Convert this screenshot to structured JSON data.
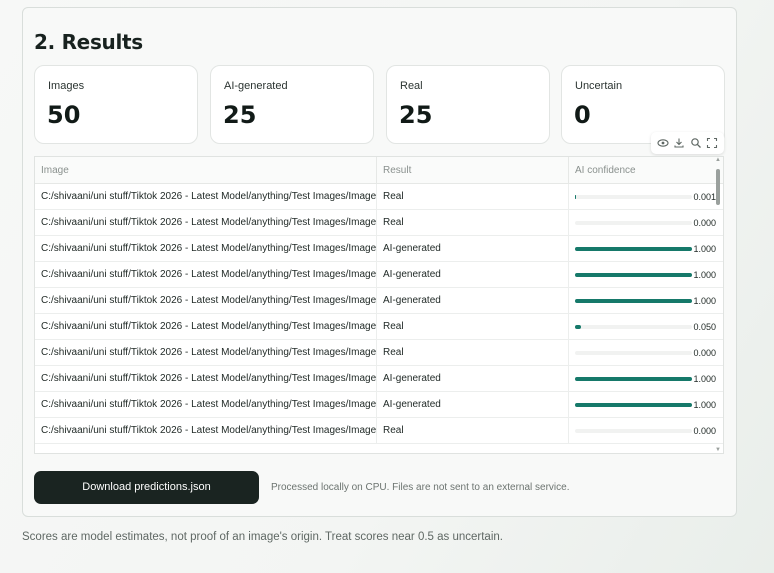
{
  "section": {
    "title": "2. Results"
  },
  "metrics": [
    {
      "label": "Images",
      "value": "50"
    },
    {
      "label": "AI-generated",
      "value": "25"
    },
    {
      "label": "Real",
      "value": "25"
    },
    {
      "label": "Uncertain",
      "value": "0"
    }
  ],
  "toolbar": {
    "icons": [
      "eye-icon",
      "download-icon",
      "search-icon",
      "fullscreen-icon"
    ]
  },
  "table": {
    "columns": [
      "Image",
      "Result",
      "AI confidence"
    ],
    "bar_color": "#16796a",
    "rows": [
      {
        "image": "C:/shivaani/uni stuff/Tiktok 2026 - Latest Model/anything/Test Images/Images",
        "result": "Real",
        "confidence": 0.001,
        "confidence_text": "0.001"
      },
      {
        "image": "C:/shivaani/uni stuff/Tiktok 2026 - Latest Model/anything/Test Images/Images",
        "result": "Real",
        "confidence": 0.0,
        "confidence_text": "0.000"
      },
      {
        "image": "C:/shivaani/uni stuff/Tiktok 2026 - Latest Model/anything/Test Images/Images",
        "result": "AI-generated",
        "confidence": 1.0,
        "confidence_text": "1.000"
      },
      {
        "image": "C:/shivaani/uni stuff/Tiktok 2026 - Latest Model/anything/Test Images/Images",
        "result": "AI-generated",
        "confidence": 1.0,
        "confidence_text": "1.000"
      },
      {
        "image": "C:/shivaani/uni stuff/Tiktok 2026 - Latest Model/anything/Test Images/Images",
        "result": "AI-generated",
        "confidence": 1.0,
        "confidence_text": "1.000"
      },
      {
        "image": "C:/shivaani/uni stuff/Tiktok 2026 - Latest Model/anything/Test Images/Images",
        "result": "Real",
        "confidence": 0.05,
        "confidence_text": "0.050"
      },
      {
        "image": "C:/shivaani/uni stuff/Tiktok 2026 - Latest Model/anything/Test Images/Images",
        "result": "Real",
        "confidence": 0.0,
        "confidence_text": "0.000"
      },
      {
        "image": "C:/shivaani/uni stuff/Tiktok 2026 - Latest Model/anything/Test Images/Images",
        "result": "AI-generated",
        "confidence": 1.0,
        "confidence_text": "1.000"
      },
      {
        "image": "C:/shivaani/uni stuff/Tiktok 2026 - Latest Model/anything/Test Images/Images",
        "result": "AI-generated",
        "confidence": 1.0,
        "confidence_text": "1.000"
      },
      {
        "image": "C:/shivaani/uni stuff/Tiktok 2026 - Latest Model/anything/Test Images/Images",
        "result": "Real",
        "confidence": 0.0,
        "confidence_text": "0.000"
      }
    ]
  },
  "download": {
    "label": "Download predictions.json"
  },
  "note": "Processed locally on CPU. Files are not sent to an external service.",
  "footer": "Scores are model estimates, not proof of an image's origin. Treat scores near 0.5 as uncertain."
}
